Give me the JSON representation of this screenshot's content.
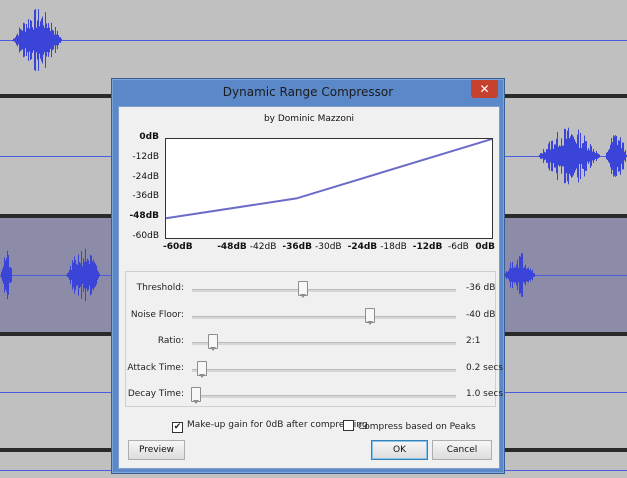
{
  "dialog": {
    "title": "Dynamic Range Compressor",
    "close_label": "✕",
    "byline": "by Dominic Mazzoni"
  },
  "graph": {
    "y_labels": [
      "0dB",
      "-12dB",
      "-24dB",
      "-36dB",
      "-48dB",
      "-60dB"
    ],
    "x_labels": [
      "-60dB",
      "-48dB",
      "-42dB",
      "-36dB",
      "-30dB",
      "-24dB",
      "-18dB",
      "-12dB",
      "-6dB",
      "0dB"
    ],
    "curve": {
      "x": [
        -60,
        -36,
        0
      ],
      "y": [
        -48,
        -36,
        0
      ]
    },
    "line_color": "#6b6bc8"
  },
  "controls": [
    {
      "label": "Threshold:",
      "value": "-36 dB",
      "fraction": 0.415
    },
    {
      "label": "Noise Floor:",
      "value": "-40 dB",
      "fraction": 0.67
    },
    {
      "label": "Ratio:",
      "value": "2:1",
      "fraction": 0.075
    },
    {
      "label": "Attack Time:",
      "value": "0.2 secs",
      "fraction": 0.035
    },
    {
      "label": "Decay Time:",
      "value": "1.0 secs",
      "fraction": 0.01
    }
  ],
  "options": {
    "makeup_gain_label": "Make-up gain for 0dB after compressing",
    "makeup_gain_checked": true,
    "peaks_label": "Compress based on Peaks",
    "peaks_checked": false
  },
  "buttons": {
    "preview": "Preview",
    "ok": "OK",
    "cancel": "Cancel"
  },
  "colors": {
    "waveform": "#3a45d8",
    "selected_track": "#8c8ca8",
    "track_bg": "#c0c0c0"
  }
}
